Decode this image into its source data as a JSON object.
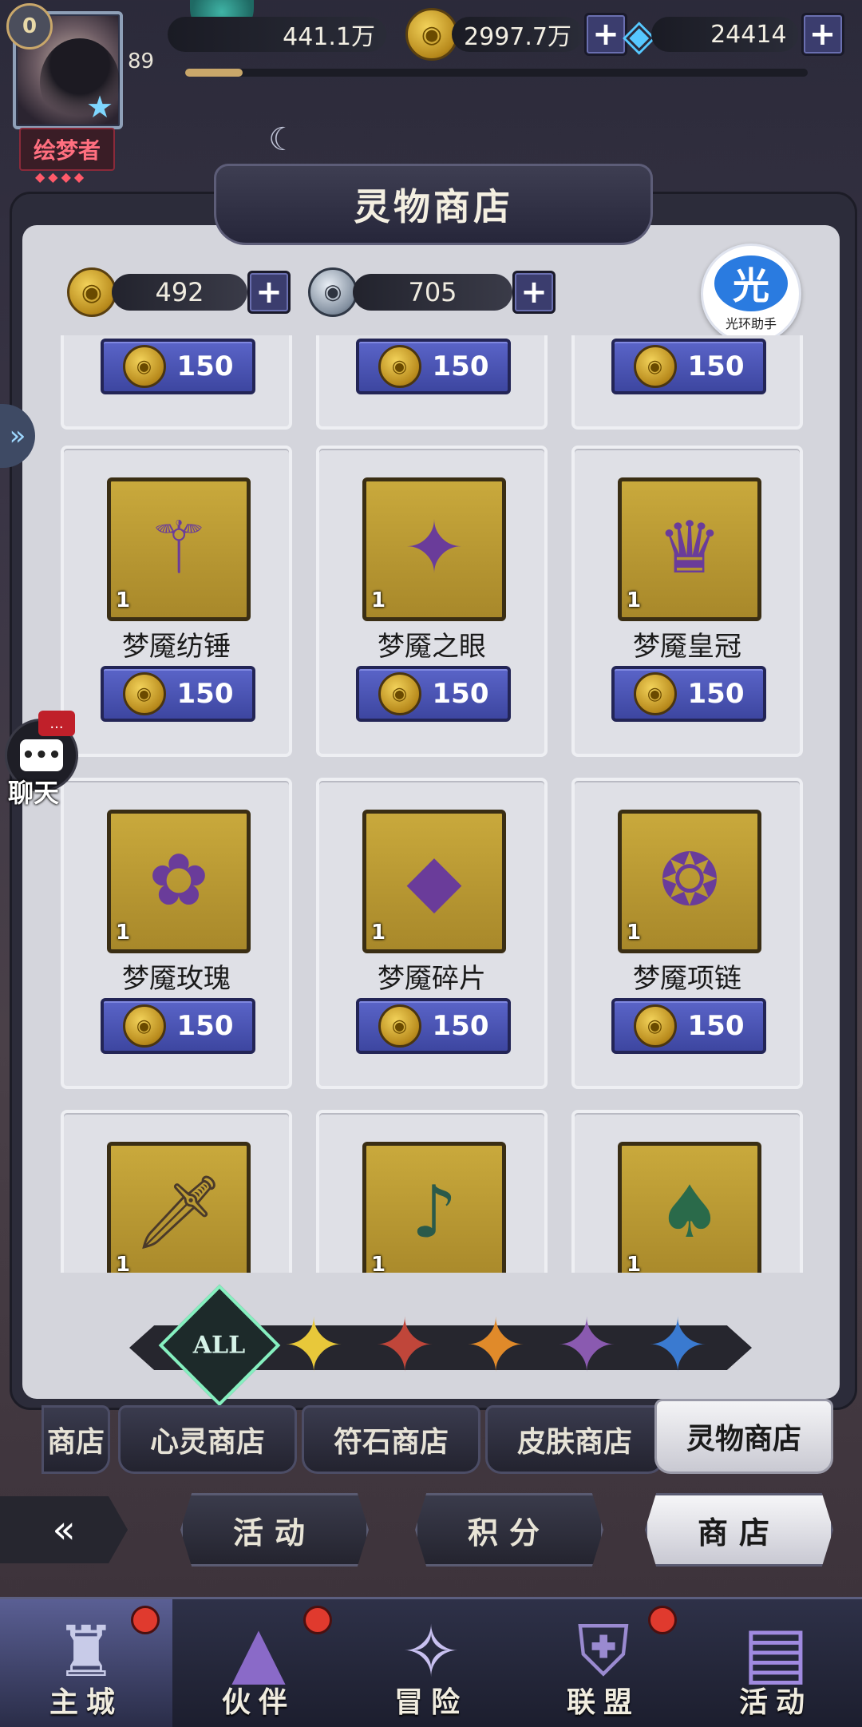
{
  "hud": {
    "vip_level": "0",
    "player_level": "89",
    "player_title": "绘梦者",
    "title_dots": "◆◆◆◆",
    "resource_1": "441.1万",
    "gold": "2997.7万",
    "diamonds": "24414",
    "plus": "+"
  },
  "shop": {
    "title": "灵物商店",
    "currency_gold": "492",
    "currency_silver": "705",
    "plus": "+",
    "helper_icon": "光",
    "helper_text": "光环助手",
    "items": [
      {
        "name": "",
        "count": "",
        "price": "150",
        "icon": "hidden-item"
      },
      {
        "name": "",
        "count": "",
        "price": "150",
        "icon": "hidden-item"
      },
      {
        "name": "",
        "count": "",
        "price": "150",
        "icon": "hidden-item"
      },
      {
        "name": "梦魇纺锤",
        "count": "1",
        "price": "150",
        "icon": "spindle-icon",
        "glyph": "⚚"
      },
      {
        "name": "梦魇之眼",
        "count": "1",
        "price": "150",
        "icon": "eye-gem-icon",
        "glyph": "✦"
      },
      {
        "name": "梦魇皇冠",
        "count": "1",
        "price": "150",
        "icon": "crown-icon",
        "glyph": "♛"
      },
      {
        "name": "梦魇玫瑰",
        "count": "1",
        "price": "150",
        "icon": "rose-icon",
        "glyph": "✿"
      },
      {
        "name": "梦魇碎片",
        "count": "1",
        "price": "150",
        "icon": "crystal-shard-icon",
        "glyph": "◆"
      },
      {
        "name": "梦魇项链",
        "count": "1",
        "price": "150",
        "icon": "necklace-icon",
        "glyph": "❂"
      },
      {
        "name": "",
        "count": "1",
        "price": "",
        "icon": "dagger-icon",
        "glyph": "🗡"
      },
      {
        "name": "",
        "count": "1",
        "price": "",
        "icon": "flute-icon",
        "glyph": "♪"
      },
      {
        "name": "",
        "count": "1",
        "price": "",
        "icon": "feathered-hat-icon",
        "glyph": "♠"
      }
    ],
    "filters": [
      {
        "label": "ALL",
        "icon": "all-filter-icon",
        "color": "#86f0c0"
      },
      {
        "label": "",
        "icon": "yellow-star-icon",
        "color": "#e8c83a"
      },
      {
        "label": "",
        "icon": "red-star-icon",
        "color": "#c0463a"
      },
      {
        "label": "",
        "icon": "orange-star-icon",
        "color": "#e08a2a"
      },
      {
        "label": "",
        "icon": "purple-star-icon",
        "color": "#8a5ab0"
      },
      {
        "label": "",
        "icon": "blue-star-icon",
        "color": "#3a7ad0"
      }
    ]
  },
  "category_tabs": [
    "商店",
    "心灵商店",
    "符石商店",
    "皮肤商店",
    "灵物商店"
  ],
  "sub_nav": {
    "back_icon": "«",
    "items": [
      "活动",
      "积分",
      "商店"
    ]
  },
  "bottom_nav": [
    {
      "label": "主城",
      "icon": "castle-icon",
      "glyph": "♜",
      "badge": true
    },
    {
      "label": "伙伴",
      "icon": "witch-hat-icon",
      "glyph": "▲",
      "badge": true
    },
    {
      "label": "冒险",
      "icon": "compass-icon",
      "glyph": "✧",
      "badge": false
    },
    {
      "label": "联盟",
      "icon": "shield-icon",
      "glyph": "⛨",
      "badge": true
    },
    {
      "label": "活动",
      "icon": "cards-icon",
      "glyph": "▤",
      "badge": false
    }
  ],
  "chat": {
    "label": "聊天",
    "notify": "...",
    "bubble": "•••"
  },
  "colors": {
    "accent_purple": "#3d46a0",
    "gold": "#c9a93c",
    "panel": "#d4d5dc"
  }
}
